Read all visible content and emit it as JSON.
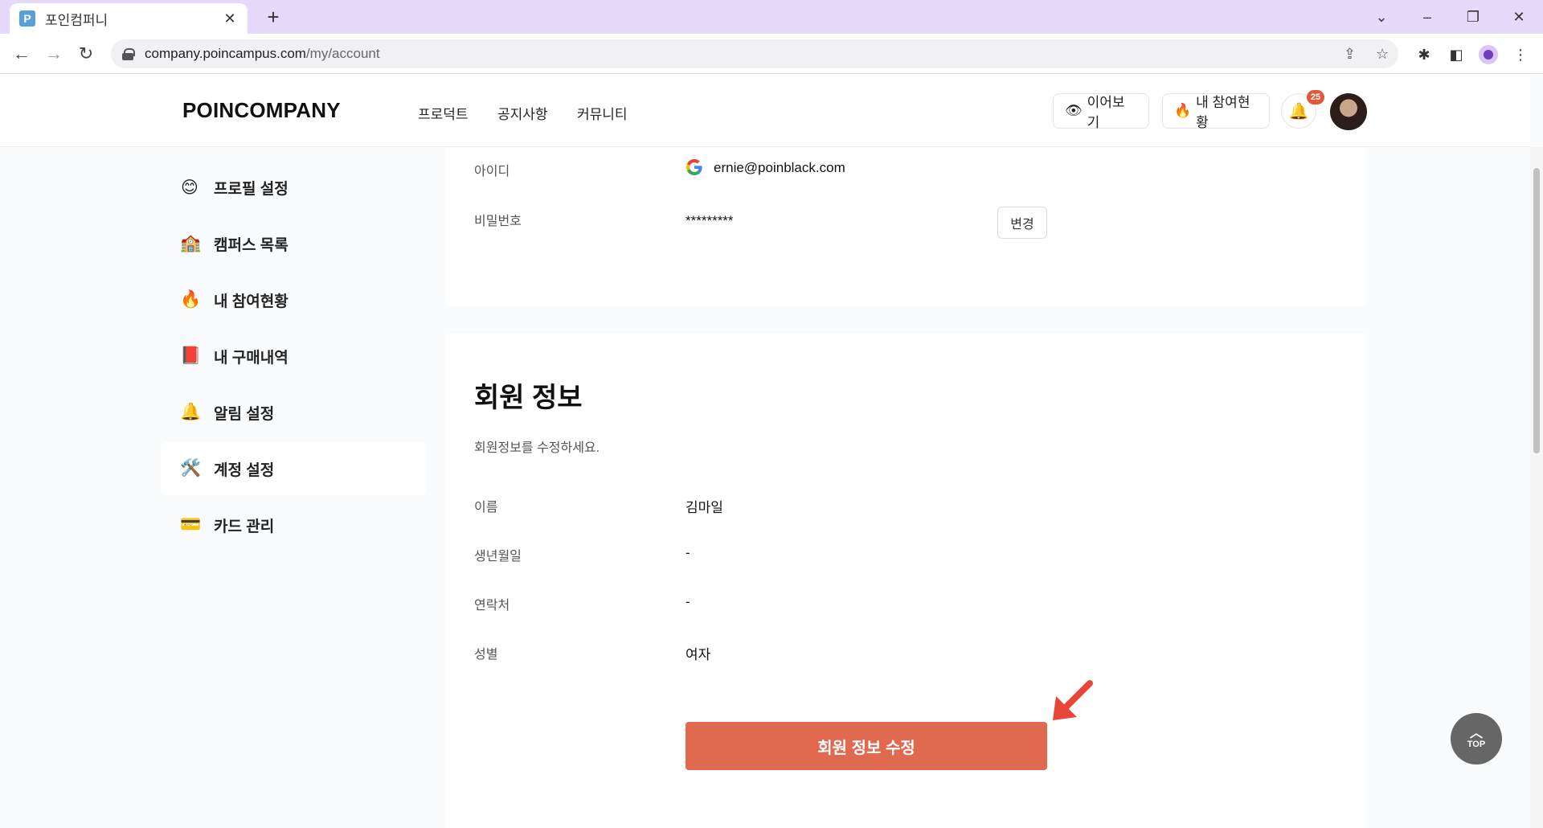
{
  "browser": {
    "tab_title": "포인컴퍼니",
    "tab_favicon": "P",
    "url_host": "company.poincampus.com",
    "url_path": "/my/account"
  },
  "header": {
    "logo": "POINCOMPANY",
    "menu": [
      "프로덕트",
      "공지사항",
      "커뮤니티"
    ],
    "resume_label": "이어보기",
    "my_progress_label": "내 참여현황",
    "notification_count": "25"
  },
  "sidebar": {
    "items": [
      {
        "emoji": "😊",
        "label": "프로필 설정"
      },
      {
        "emoji": "🏫",
        "label": "캠퍼스 목록"
      },
      {
        "emoji": "🔥",
        "label": "내 참여현황"
      },
      {
        "emoji": "📕",
        "label": "내 구매내역"
      },
      {
        "emoji": "🔔",
        "label": "알림 설정"
      },
      {
        "emoji": "🛠️",
        "label": "계정 설정"
      },
      {
        "emoji": "💳",
        "label": "카드 관리"
      }
    ],
    "active_index": 5
  },
  "account": {
    "id_label": "아이디",
    "id_value": "ernie@poinblack.com",
    "password_label": "비밀번호",
    "password_value": "*********",
    "change_label": "변경"
  },
  "member_info": {
    "title": "회원 정보",
    "description": "회원정보를 수정하세요.",
    "name_label": "이름",
    "name_value": "김마일",
    "birth_label": "생년월일",
    "birth_value": "-",
    "phone_label": "연락처",
    "phone_value": "-",
    "gender_label": "성별",
    "gender_value": "여자",
    "edit_button": "회원 정보 수정"
  },
  "top_button": "TOP",
  "colors": {
    "accent": "#e0694f",
    "tabbar": "#e6dafa",
    "badge": "#e05a3a"
  }
}
